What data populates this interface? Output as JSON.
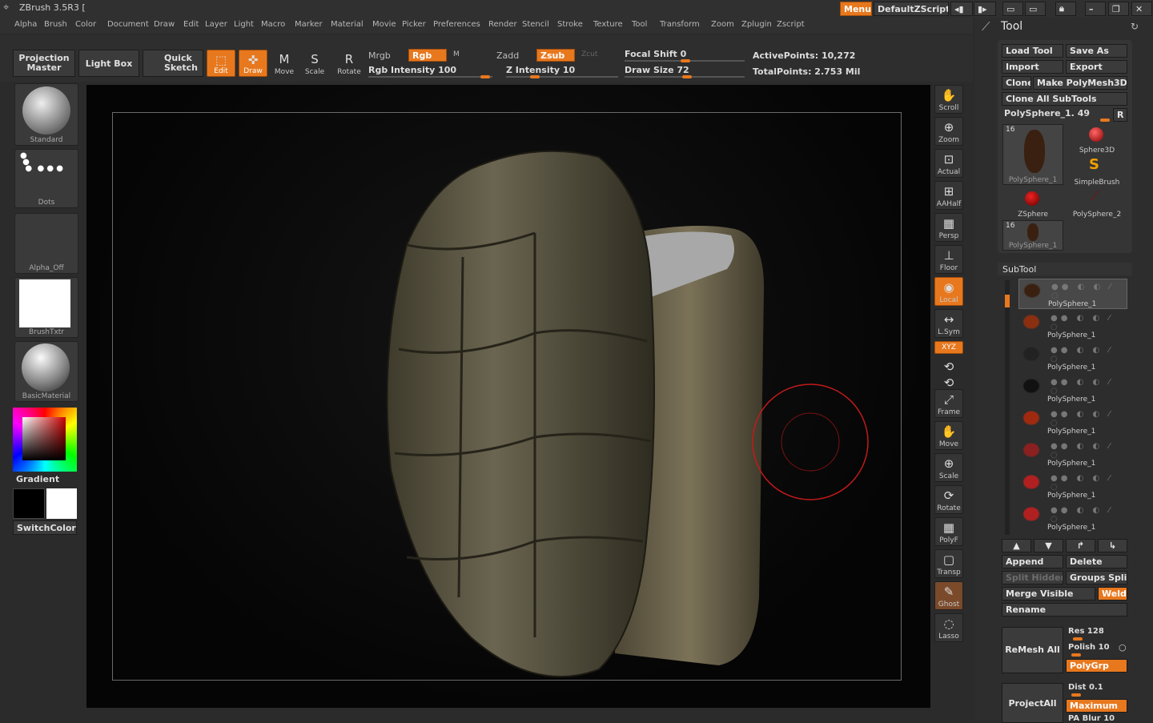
{
  "app": {
    "title": "ZBrush 3.5R3 [",
    "menus_button": "Menus",
    "script_button": "DefaultZScript"
  },
  "menubar": [
    "Alpha",
    "Brush",
    "Color",
    "Document",
    "Draw",
    "Edit",
    "Layer",
    "Light",
    "Macro",
    "Marker",
    "Material",
    "Movie",
    "Picker",
    "Preferences",
    "Render",
    "Stencil",
    "Stroke",
    "Texture",
    "Tool",
    "Transform",
    "Zoom",
    "Zplugin",
    "Zscript"
  ],
  "toolbar": {
    "projection_master": "Projection Master",
    "light_box": "Light Box",
    "quick_sketch": "Quick Sketch",
    "edit": "Edit",
    "draw": "Draw",
    "move": "Move",
    "scale": "Scale",
    "rotate": "Rotate",
    "mrgb": "Mrgb",
    "rgb": "Rgb",
    "m": "M",
    "zadd": "Zadd",
    "zsub": "Zsub",
    "zcut": "Zcut",
    "rgb_intensity": "Rgb Intensity 100",
    "z_intensity": "Z Intensity 10",
    "focal_shift": "Focal Shift 0",
    "draw_size": "Draw Size 72",
    "active_points": "ActivePoints: 10,272",
    "total_points": "TotalPoints: 2.753 Mil"
  },
  "left_shelf": {
    "brush": "Standard",
    "stroke": "Dots",
    "alpha": "Alpha_Off",
    "texture": "BrushTxtr",
    "material": "BasicMaterial",
    "gradient": "Gradient",
    "switch_color": "SwitchColor",
    "colors": {
      "primary": "#000000",
      "secondary": "#ffffff"
    }
  },
  "right_shelf": [
    "Scroll",
    "Zoom",
    "Actual",
    "AAHalf",
    "Persp",
    "Floor",
    "Local",
    "L.Sym",
    "XYZ",
    "",
    "",
    "Frame",
    "Move",
    "Scale",
    "Rotate",
    "PolyF",
    "Transp",
    "Ghost",
    "Lasso"
  ],
  "tool_panel": {
    "title": "Tool",
    "load_tool": "Load Tool",
    "save_as": "Save As",
    "import": "Import",
    "export": "Export",
    "clone": "Clone",
    "make_polymesh": "Make PolyMesh3D",
    "clone_all": "Clone All SubTools",
    "current_tool": "PolySphere_1. 49",
    "r_button": "R",
    "tools": [
      {
        "name": "PolySphere_1",
        "count": "16"
      },
      {
        "name": "Sphere3D",
        "count": ""
      },
      {
        "name": "SimpleBrush",
        "count": ""
      },
      {
        "name": "ZSphere",
        "count": ""
      },
      {
        "name": "PolySphere_2",
        "count": ""
      },
      {
        "name": "PolySphere_1",
        "count": "16"
      }
    ],
    "subtool_title": "SubTool",
    "subtools": [
      "PolySphere_1",
      "PolySphere_1",
      "PolySphere_1",
      "PolySphere_1",
      "PolySphere_1",
      "PolySphere_1",
      "PolySphere_1",
      "PolySphere_1"
    ],
    "append": "Append",
    "delete": "Delete",
    "split_hidden": "Split Hidden",
    "groups_split": "Groups Split",
    "merge_visible": "Merge Visible",
    "weld": "Weld",
    "rename": "Rename",
    "remesh_all": "ReMesh All",
    "res": "Res 128",
    "polish": "Polish 10",
    "polygrp": "PolyGrp",
    "project_all": "ProjectAll",
    "dist": "Dist 0.1",
    "maximum": "Maximum",
    "pa_blur": "PA Blur 10"
  },
  "accent": "#e8781e"
}
